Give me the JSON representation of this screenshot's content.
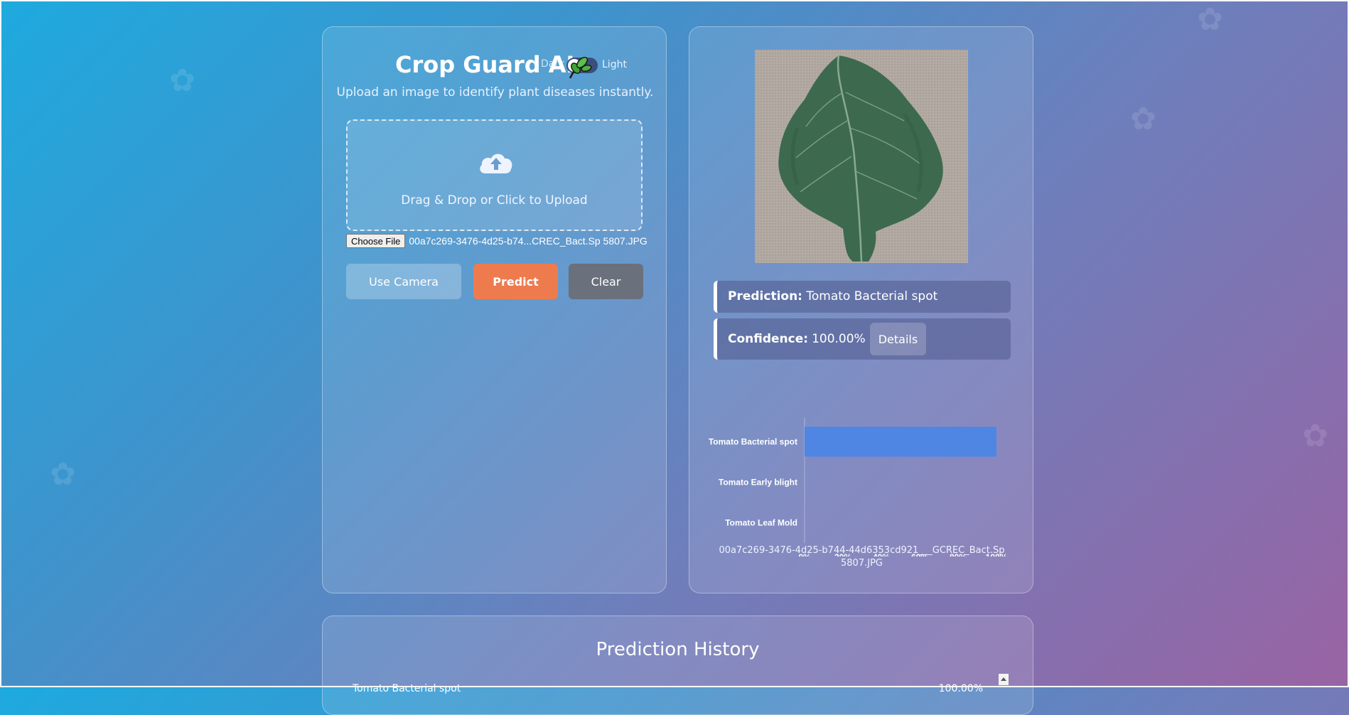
{
  "app": {
    "title": "Crop Guard AI",
    "subtitle": "Upload an image to identify plant diseases instantly.",
    "theme_toggle": {
      "dark_label": "Dark",
      "light_label": "Light"
    }
  },
  "upload": {
    "dropzone_text": "Drag & Drop or Click to Upload",
    "choose_file_label": "Choose File",
    "file_name": "00a7c269-3476-4d25-b74...CREC_Bact.Sp 5807.JPG"
  },
  "buttons": {
    "camera": "Use Camera",
    "predict": "Predict",
    "clear": "Clear"
  },
  "result": {
    "prediction_label": "Prediction:",
    "prediction_value": "Tomato Bacterial spot",
    "confidence_label": "Confidence:",
    "confidence_value": "100.00%",
    "details_label": "Details",
    "file_caption": "00a7c269-3476-4d25-b744-44d6353cd921___GCREC_Bact.Sp 5807.JPG"
  },
  "chart_data": {
    "type": "bar",
    "orientation": "horizontal",
    "categories": [
      "Tomato Bacterial spot",
      "Tomato Early blight",
      "Tomato Leaf Mold"
    ],
    "values": [
      100,
      0,
      0
    ],
    "xlim": [
      0,
      100
    ],
    "x_ticks": [
      "0%",
      "20%",
      "40%",
      "60%",
      "80%",
      "100%"
    ],
    "bar_color": "#4f85e3",
    "title": "",
    "xlabel": "",
    "ylabel": ""
  },
  "history": {
    "title": "Prediction History",
    "rows": [
      {
        "label": "Tomato Bacterial spot",
        "value": "100.00%"
      }
    ]
  },
  "colors": {
    "accent": "#ee7b4e",
    "bar": "#4f85e3"
  }
}
